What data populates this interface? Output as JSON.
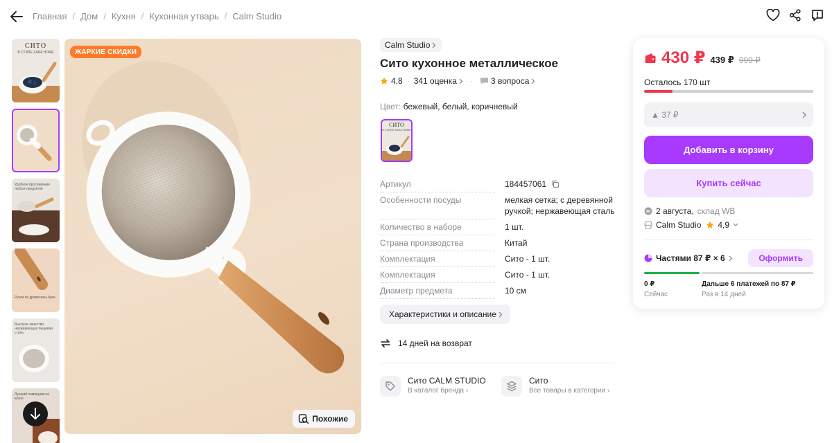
{
  "breadcrumbs": [
    "Главная",
    "Дом",
    "Кухня",
    "Кухонная утварь",
    "Calm Studio"
  ],
  "gallery": {
    "badge": "ЖАРКИЕ СКИДКИ",
    "similar_label": "Похожие",
    "thumb_captions": {
      "t1": "СИТО",
      "t1_sub": "В СТИЛЕ ZARA HOME",
      "t3": "Удобное просеивание любых продуктов",
      "t4": "Ручка из древесины бука",
      "t5": "Высокое качество: нержавеющая пищевая сталь",
      "t6": "Лучший помощник на кухне"
    }
  },
  "product": {
    "brand": "Calm Studio",
    "title": "Сито кухонное металлическое",
    "rating": "4,8",
    "reviews": "341 оценка",
    "questions": "3 вопроса",
    "color_label": "Цвет:",
    "color_value": "бежевый, белый, коричневый",
    "swatch_title": "СИТО",
    "swatch_sub": "В СТИЛЕ ZARA HOME",
    "specs": [
      {
        "key": "Артикул",
        "value": "184457061"
      },
      {
        "key": "Особенности посуды",
        "value": "мелкая сетка; с деревянной ручкой; нержавеющая сталь"
      },
      {
        "key": "Количество в наборе",
        "value": "1 шт."
      },
      {
        "key": "Страна производства",
        "value": "Китай"
      },
      {
        "key": "Комплектация",
        "value": "Сито - 1 шт."
      },
      {
        "key": "Комплектация",
        "value": "Сито - 1 шт."
      },
      {
        "key": "Диаметр предмета",
        "value": "10 см"
      }
    ],
    "characteristics_button": "Характеристики и описание",
    "return_text": "14 дней на возврат",
    "brand_card": {
      "title": "Сито CALM STUDIO",
      "sub": "В каталог бренда"
    },
    "category_card": {
      "title": "Сито",
      "sub": "Все товары в категории"
    }
  },
  "buy": {
    "price": "430 ₽",
    "price_wallet": "439 ₽",
    "price_old": "999 ₽",
    "stock_text": "Осталось 170 шт",
    "stock_fraction": 0.17,
    "coupon": "▲ 37 ₽",
    "add_to_cart": "Добавить в корзину",
    "buy_now": "Купить сейчас",
    "delivery_date": "2 августа,",
    "delivery_place": "склад WB",
    "seller": "Calm Studio",
    "seller_rating": "4,9",
    "installments": "Частями 87 ₽ × 6",
    "checkout": "Оформить",
    "plan_now_title": "0 ₽",
    "plan_now_sub": "Сейчас",
    "plan_later_title": "Дальше 6 платежей по 87 ₽",
    "plan_later_sub": "Раз в 14 дней"
  },
  "colors": {
    "accent": "#a73afd",
    "price": "#f2364c",
    "badge": "#ff7a29",
    "progress_green": "#1eb24a"
  }
}
